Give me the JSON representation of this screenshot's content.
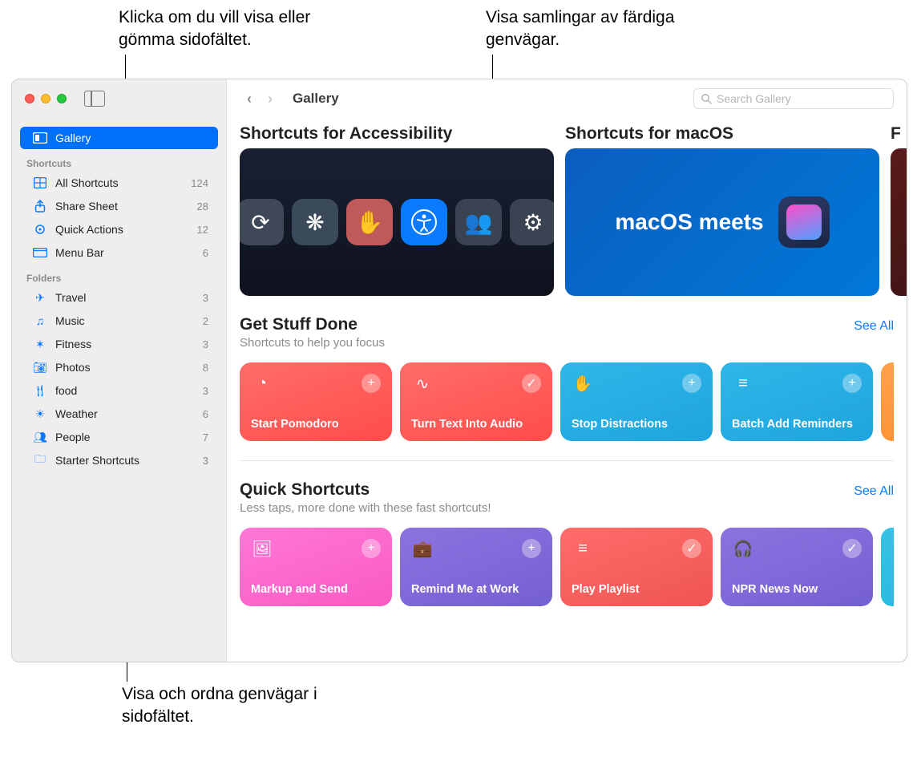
{
  "callouts": {
    "sidebar_toggle": "Klicka om du vill visa eller gömma sidofältet.",
    "collections": "Visa samlingar av färdiga genvägar.",
    "sidebar_view": "Visa och ordna genvägar i sidofältet."
  },
  "toolbar": {
    "title": "Gallery",
    "search_placeholder": "Search Gallery"
  },
  "sidebar": {
    "gallery_label": "Gallery",
    "shortcuts_header": "Shortcuts",
    "folders_header": "Folders",
    "shortcuts": [
      {
        "icon": "grid",
        "label": "All Shortcuts",
        "count": "124"
      },
      {
        "icon": "share",
        "label": "Share Sheet",
        "count": "28"
      },
      {
        "icon": "gear",
        "label": "Quick Actions",
        "count": "12"
      },
      {
        "icon": "menubar",
        "label": "Menu Bar",
        "count": "6"
      }
    ],
    "folders": [
      {
        "icon": "plane",
        "label": "Travel",
        "count": "3"
      },
      {
        "icon": "music",
        "label": "Music",
        "count": "2"
      },
      {
        "icon": "fitness",
        "label": "Fitness",
        "count": "3"
      },
      {
        "icon": "camera",
        "label": "Photos",
        "count": "8"
      },
      {
        "icon": "fork",
        "label": "food",
        "count": "3"
      },
      {
        "icon": "sun",
        "label": "Weather",
        "count": "6"
      },
      {
        "icon": "people",
        "label": "People",
        "count": "7"
      },
      {
        "icon": "folder",
        "label": "Starter Shortcuts",
        "count": "3"
      }
    ]
  },
  "heroes": [
    {
      "title": "Shortcuts for Accessibility"
    },
    {
      "title": "Shortcuts for macOS",
      "text": "macOS meets"
    },
    {
      "title": "F"
    }
  ],
  "sections": [
    {
      "title": "Get Stuff Done",
      "subtitle": "Shortcuts to help you focus",
      "see_all": "See All",
      "cards": [
        {
          "name": "Start Pomodoro",
          "color": "c-red",
          "action": "plus",
          "glyph": "◔"
        },
        {
          "name": "Turn Text Into Audio",
          "color": "c-red",
          "action": "check",
          "glyph": "∿"
        },
        {
          "name": "Stop Distractions",
          "color": "c-blue",
          "action": "plus",
          "glyph": "✋"
        },
        {
          "name": "Batch Add Reminders",
          "color": "c-blue",
          "action": "plus",
          "glyph": "≡"
        },
        {
          "name": "",
          "color": "c-orange",
          "action": "plus",
          "glyph": ""
        }
      ]
    },
    {
      "title": "Quick Shortcuts",
      "subtitle": "Less taps, more done with these fast shortcuts!",
      "see_all": "See All",
      "cards": [
        {
          "name": "Markup and Send",
          "color": "c-pink",
          "action": "plus",
          "glyph": "🖼"
        },
        {
          "name": "Remind Me at Work",
          "color": "c-purple",
          "action": "plus",
          "glyph": "💼"
        },
        {
          "name": "Play Playlist",
          "color": "c-coral",
          "action": "check",
          "glyph": "≡"
        },
        {
          "name": "NPR News Now",
          "color": "c-purple",
          "action": "check",
          "glyph": "🎧"
        },
        {
          "name": "",
          "color": "c-cyan",
          "action": "plus",
          "glyph": ""
        }
      ]
    }
  ]
}
